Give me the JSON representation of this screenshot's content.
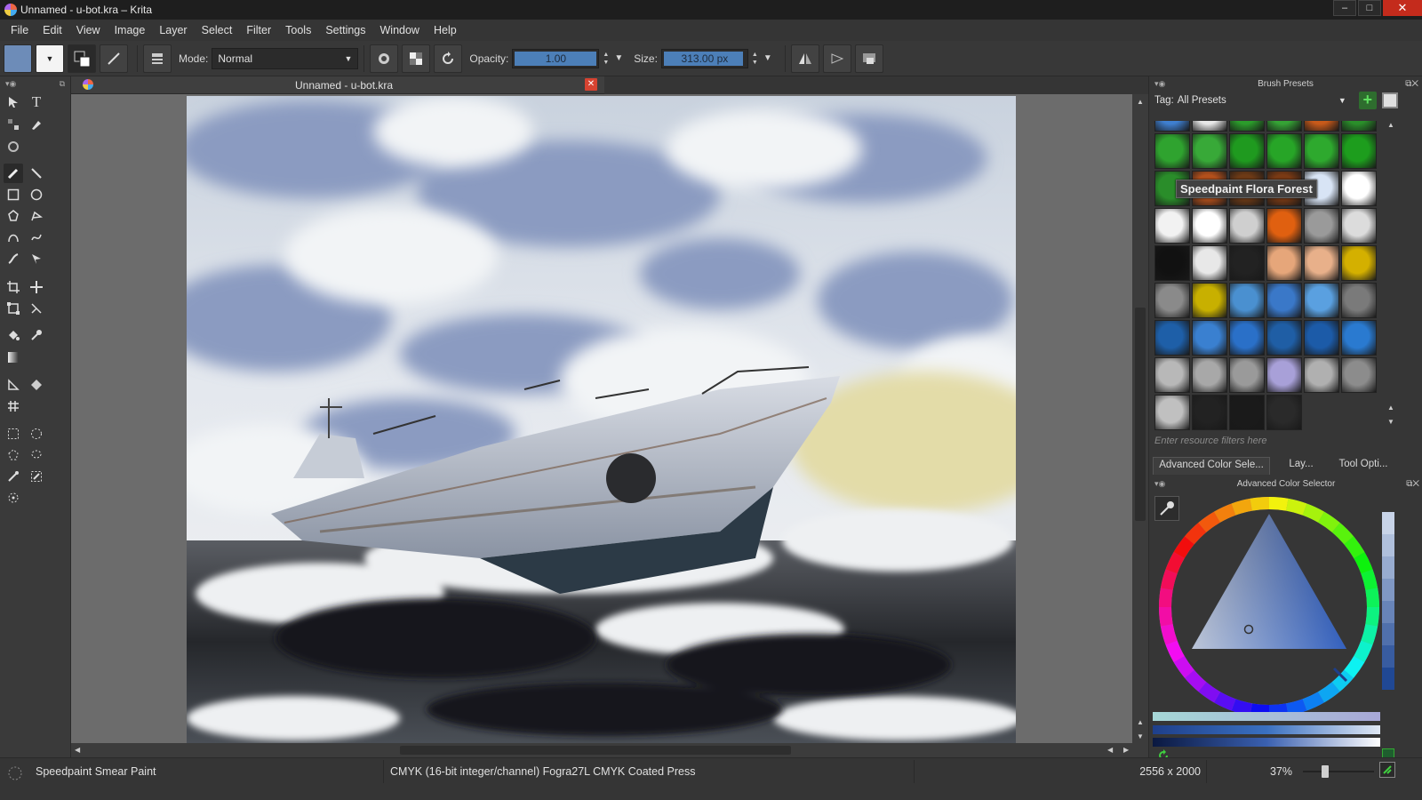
{
  "window": {
    "title": "Unnamed - u-bot.kra – Krita",
    "minimize_label": "–",
    "maximize_label": "□",
    "close_label": "✕"
  },
  "menubar": {
    "items": [
      "File",
      "Edit",
      "View",
      "Image",
      "Layer",
      "Select",
      "Filter",
      "Tools",
      "Settings",
      "Window",
      "Help"
    ]
  },
  "toolbar": {
    "mode_label": "Mode:",
    "mode_value": "Normal",
    "opacity_label": "Opacity:",
    "opacity_value": "1.00",
    "opacity_fraction": 1.0,
    "size_label": "Size:",
    "size_value": "313.00 px",
    "size_fraction": 0.97,
    "icons": [
      "brush-settings-icon",
      "reset-icon",
      "alpha-lock-icon",
      "refresh-icon",
      "mirror-horizontal-icon",
      "mirror-vertical-icon",
      "workspace-icon"
    ]
  },
  "document": {
    "tab_title": "Unnamed - u-bot.kra",
    "close_label": "✕"
  },
  "brush_presets": {
    "docker_title": "Brush Presets",
    "tag_label": "Tag:",
    "tag_value": "All Presets",
    "add_label": "+",
    "filter_placeholder": "Enter resource filters here",
    "tooltip": "Speedpaint Flora Forest",
    "rows": [
      [
        "#3f7fd0",
        "#e8e8e8",
        "#2b9c2b",
        "#35a335",
        "#c85a1a",
        "#2a8f2a"
      ],
      [
        "#2fa32f",
        "#38a938",
        "#1f9a1f",
        "#27a527",
        "#2ea92e",
        "#1d9d1d"
      ],
      [
        "#2a8d2a",
        "#b3501c",
        "#6d3a16",
        "#7a3a14",
        "#d8e4f5",
        "#ffffff"
      ],
      [
        "#f2f2f2",
        "#ffffff",
        "#cfcfcf",
        "#e06010",
        "#9a9a9a",
        "#dcdcdc"
      ],
      [
        "#111111",
        "#e8e8e8",
        "#222222",
        "#e6a67a",
        "#e8b08a",
        "#d4b000"
      ],
      [
        "#8a8a8a",
        "#c8b000",
        "#4a90d0",
        "#3a78c8",
        "#5aa0e0",
        "#7a7a7a"
      ],
      [
        "#1e5fa8",
        "#3a80d0",
        "#2a70c8",
        "#1f5ea5",
        "#1c5ba8",
        "#2a7ad0"
      ],
      [
        "#b8b8b8",
        "#a8a8a8",
        "#9a9a9a",
        "#a8a0d8",
        "#b0b0b0",
        "#8c8c8c"
      ],
      [
        "#c0c0c0",
        "#222222",
        "#1a1a1a",
        "#2a2a2a"
      ]
    ]
  },
  "docker_tabs": [
    "Advanced Color Sele...",
    "Lay...",
    "Tool Opti..."
  ],
  "color_selector": {
    "docker_title": "Advanced Color Selector",
    "current_color": "#1e3f8a"
  },
  "statusbar": {
    "brush": "Speedpaint Smear Paint",
    "color_space": "CMYK (16-bit integer/channel)  Fogra27L CMYK Coated Press",
    "dimensions": "2556 x 2000",
    "zoom": "37%",
    "zoom_fraction": 0.37
  }
}
